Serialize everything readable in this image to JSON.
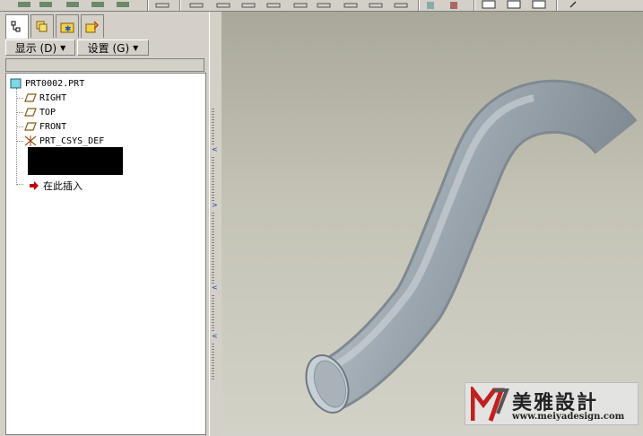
{
  "toolbar": {
    "icons": [
      "view-icon",
      "view-icon",
      "view-icon",
      "zoom-icon",
      "datum-icon",
      "datum-icon",
      "datum-icon",
      "datum-icon",
      "datum-icon",
      "datum-icon",
      "datum-icon",
      "layer-icon",
      "tool-icon",
      "window-icon",
      "window-icon",
      "window-icon",
      "help-icon"
    ]
  },
  "model_tree": {
    "tabs": [
      "model-tree-tab",
      "folder-browser-tab",
      "favorites-tab",
      "connections-tab"
    ],
    "show_menu": "显示 (D)",
    "settings_menu": "设置 (G)",
    "root": "PRT0002.PRT",
    "items": [
      {
        "label": "RIGHT",
        "icon": "datum-plane-icon"
      },
      {
        "label": "TOP",
        "icon": "datum-plane-icon"
      },
      {
        "label": "FRONT",
        "icon": "datum-plane-icon"
      },
      {
        "label": "PRT_CSYS_DEF",
        "icon": "coordinate-system-icon"
      }
    ],
    "insert_here": "在此插入"
  },
  "watermark": {
    "title": "美雅設計",
    "url": "www.meiyadesign.com"
  },
  "colors": {
    "window_bg": "#d4d0c8",
    "viewport_top": "#a9a89a",
    "viewport_bottom": "#d3d2c8",
    "pipe": "#a4adb5",
    "insert_arrow": "#c00000"
  }
}
